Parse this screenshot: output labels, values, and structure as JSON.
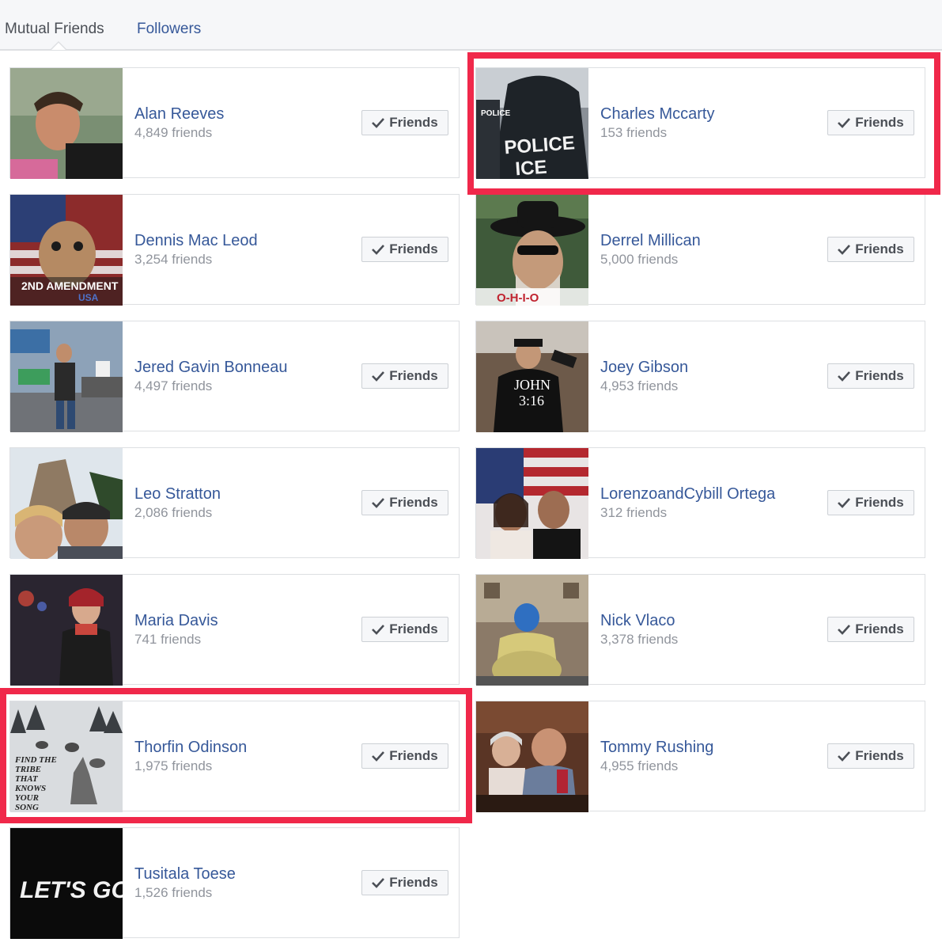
{
  "tabs": {
    "mutual_friends": "Mutual Friends",
    "followers": "Followers"
  },
  "friends": [
    {
      "name": "Alan Reeves",
      "count": "4,849 friends",
      "button": "Friends",
      "highlighted": false,
      "photo_icon": "man-portrait"
    },
    {
      "name": "Charles Mccarty",
      "count": "153 friends",
      "button": "Friends",
      "highlighted": true,
      "photo_icon": "police-ice-jacket",
      "photo_text": [
        "POLICE",
        "ICE"
      ]
    },
    {
      "name": "Dennis Mac Leod",
      "count": "3,254 friends",
      "button": "Friends",
      "highlighted": false,
      "photo_icon": "dog-flag",
      "photo_text": [
        "2ND AMENDMENT",
        "USA"
      ]
    },
    {
      "name": "Derrel Millican",
      "count": "5,000 friends",
      "button": "Friends",
      "highlighted": false,
      "photo_icon": "cowboy-hat-man",
      "photo_text": [
        "O-H-I-O"
      ]
    },
    {
      "name": "Jered Gavin Bonneau",
      "count": "4,497 friends",
      "button": "Friends",
      "highlighted": false,
      "photo_icon": "rally-speaker"
    },
    {
      "name": "Joey Gibson",
      "count": "4,953 friends",
      "button": "Friends",
      "highlighted": false,
      "photo_icon": "speaker-megaphone",
      "photo_text": [
        "JOHN",
        "3:16"
      ]
    },
    {
      "name": "Leo Stratton",
      "count": "2,086 friends",
      "button": "Friends",
      "highlighted": false,
      "photo_icon": "couple-selfie-mountain"
    },
    {
      "name": "LorenzoandCybill Ortega",
      "count": "312 friends",
      "button": "Friends",
      "highlighted": false,
      "photo_icon": "couple-flag"
    },
    {
      "name": "Maria Davis",
      "count": "741 friends",
      "button": "Friends",
      "highlighted": false,
      "photo_icon": "woman-vest"
    },
    {
      "name": "Nick Vlaco",
      "count": "3,378 friends",
      "button": "Friends",
      "highlighted": false,
      "photo_icon": "costumed-man-shield"
    },
    {
      "name": "Thorfin Odinson",
      "count": "1,975 friends",
      "button": "Friends",
      "highlighted": true,
      "photo_icon": "wolves-snow",
      "photo_text": [
        "FIND THE",
        "TRIBE",
        "THAT",
        "KNOWS",
        "YOUR",
        "SONG"
      ]
    },
    {
      "name": "Tommy Rushing",
      "count": "4,955 friends",
      "button": "Friends",
      "highlighted": false,
      "photo_icon": "couple-restaurant"
    },
    {
      "name": "Tusitala Toese",
      "count": "1,526 friends",
      "button": "Friends",
      "highlighted": false,
      "photo_icon": "lets-go-text",
      "photo_text": [
        "LET'S GO"
      ]
    }
  ],
  "colors": {
    "link": "#365899",
    "muted": "#90949c",
    "highlight": "#f0284a",
    "border": "#dddfe2"
  }
}
